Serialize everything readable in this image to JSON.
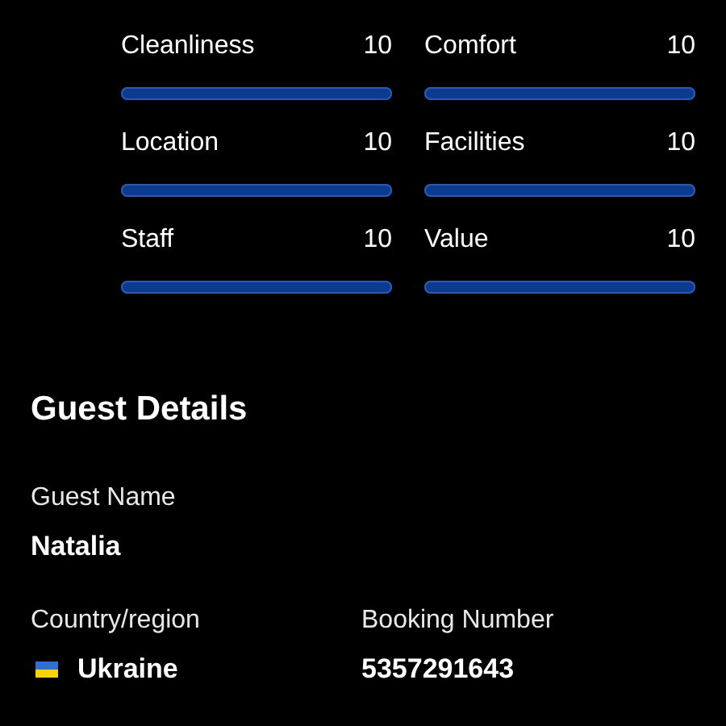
{
  "ratings": [
    {
      "label": "Cleanliness",
      "score": "10",
      "level": 1
    },
    {
      "label": "Comfort",
      "score": "10",
      "level": 1
    },
    {
      "label": "Location",
      "score": "10",
      "level": 1
    },
    {
      "label": "Facilities",
      "score": "10",
      "level": 1
    },
    {
      "label": "Staff",
      "score": "10",
      "level": 1
    },
    {
      "label": "Value",
      "score": "10",
      "level": 1
    }
  ],
  "guest_details": {
    "title": "Guest Details",
    "guest_name": {
      "label": "Guest Name",
      "value": "Natalia"
    },
    "country": {
      "label": "Country/region",
      "value": "Ukraine"
    },
    "booking_number": {
      "label": "Booking Number",
      "value": "5357291643"
    }
  }
}
